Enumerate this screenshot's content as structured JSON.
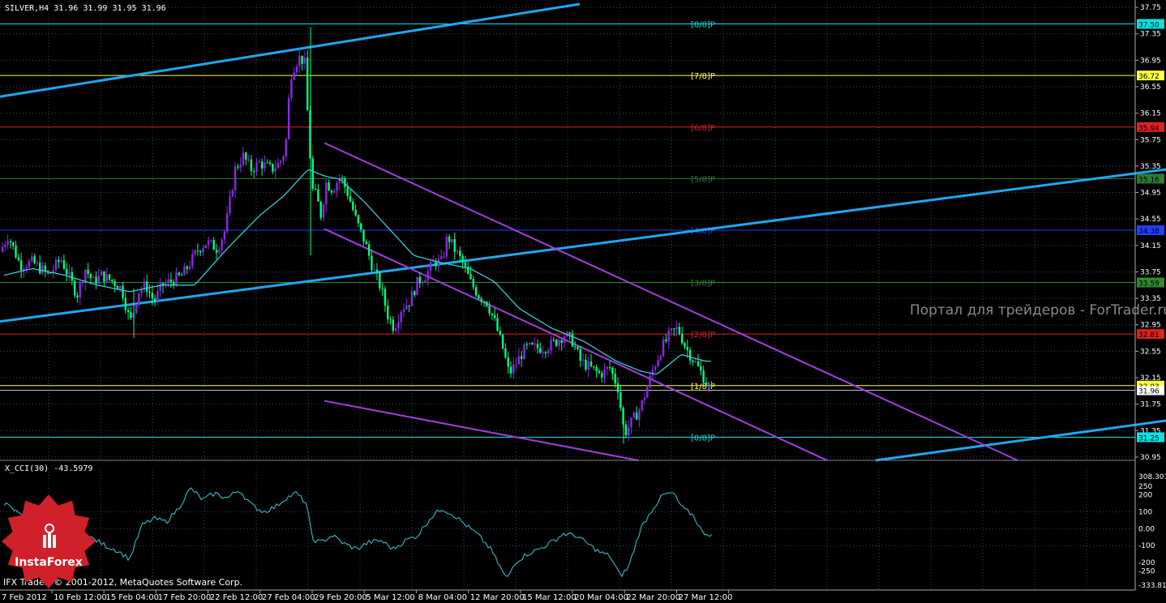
{
  "symbol_header": "SILVER,H4  31.96 31.99 31.95 31.96",
  "indicator_header": "X_CCI(30) -43.5979",
  "watermark": "Портал для трейдеров - ForTrader.ru",
  "copyright": "IFX Trader, © 2001-2012, MetaQuotes Software Corp.",
  "logo_text": "InstaForex",
  "colors": {
    "bull": "#8A2BE2",
    "bear": "#00FF7F",
    "ma": "#40C8D8",
    "channel_blue": "#1EA8F0",
    "channel_purple": "#A040E0",
    "grid": "#3A4A5A",
    "logo": "#D0202A"
  },
  "price_axis": {
    "ticks": [
      "37.75",
      "37.35",
      "36.95",
      "36.55",
      "36.15",
      "35.75",
      "35.35",
      "34.95",
      "34.55",
      "34.15",
      "33.75",
      "33.35",
      "32.95",
      "32.55",
      "32.15",
      "31.75",
      "31.35",
      "30.95"
    ],
    "min": 30.9,
    "max": 37.8
  },
  "cci_axis": {
    "ticks": [
      "308.301",
      "250",
      "200",
      "100",
      "0.00",
      "-100",
      "-200",
      "-250",
      "-333.810"
    ],
    "min": -333.81,
    "max": 308.301
  },
  "time_axis": [
    "7 Feb 2012",
    "10 Feb 12:00",
    "15 Feb 04:00",
    "17 Feb 20:00",
    "22 Feb 12:00",
    "27 Feb 04:00",
    "29 Feb 20:00",
    "5 Mar 12:00",
    "8 Mar 04:00",
    "12 Mar 20:00",
    "15 Mar 12:00",
    "20 Mar 04:00",
    "22 Mar 20:00",
    "27 Mar 12:00"
  ],
  "murrey_levels": [
    {
      "label": "[8/8]P",
      "price": 37.5,
      "tag": "37.50",
      "color": "#00E5E5"
    },
    {
      "label": "[7/8]P",
      "price": 36.72,
      "tag": "36.72",
      "color": "#FFFF40"
    },
    {
      "label": "[6/8]P",
      "price": 35.94,
      "tag": "35.94",
      "color": "#E02020"
    },
    {
      "label": "[5/8]P",
      "price": 35.16,
      "tag": "35.16",
      "color": "#2E7D32"
    },
    {
      "label": "[4/8]P",
      "price": 34.38,
      "tag": "34.38",
      "color": "#2040FF"
    },
    {
      "label": "[3/8]P",
      "price": 33.59,
      "tag": "33.59",
      "color": "#2E8B2E"
    },
    {
      "label": "[2/8]P",
      "price": 32.81,
      "tag": "32.81",
      "color": "#E02020"
    },
    {
      "label": "[1/8]P",
      "price": 32.03,
      "tag": "32.03",
      "color": "#FFFF40"
    },
    {
      "label": "[0/8]P",
      "price": 31.25,
      "tag": "31.25",
      "color": "#00E5E5"
    }
  ],
  "current_price": {
    "price": 31.96,
    "tag": "31.96"
  },
  "chart_data": {
    "type": "candlestick",
    "title": "SILVER,H4",
    "close_anchors": [
      [
        0,
        34.05
      ],
      [
        10,
        34.3
      ],
      [
        25,
        33.85
      ],
      [
        40,
        33.9
      ],
      [
        60,
        33.7
      ],
      [
        75,
        33.95
      ],
      [
        95,
        33.4
      ],
      [
        105,
        33.8
      ],
      [
        115,
        33.6
      ],
      [
        125,
        33.7
      ],
      [
        140,
        33.6
      ],
      [
        150,
        33.5
      ],
      [
        158,
        33.1
      ],
      [
        162,
        33.0
      ],
      [
        170,
        33.45
      ],
      [
        180,
        33.55
      ],
      [
        190,
        33.3
      ],
      [
        200,
        33.55
      ],
      [
        210,
        33.6
      ],
      [
        225,
        33.7
      ],
      [
        235,
        33.9
      ],
      [
        245,
        34.1
      ],
      [
        255,
        34.2
      ],
      [
        268,
        34.1
      ],
      [
        278,
        34.4
      ],
      [
        290,
        35.3
      ],
      [
        300,
        35.5
      ],
      [
        310,
        35.3
      ],
      [
        320,
        35.4
      ],
      [
        335,
        35.3
      ],
      [
        345,
        35.4
      ],
      [
        352,
        35.6
      ],
      [
        358,
        36.7
      ],
      [
        364,
        36.9
      ],
      [
        370,
        37.0
      ],
      [
        376,
        36.9
      ],
      [
        380,
        36.0
      ],
      [
        385,
        35.0
      ],
      [
        390,
        34.9
      ],
      [
        396,
        34.6
      ],
      [
        402,
        35.1
      ],
      [
        410,
        35.0
      ],
      [
        420,
        35.2
      ],
      [
        430,
        34.9
      ],
      [
        440,
        34.5
      ],
      [
        450,
        34.2
      ],
      [
        460,
        33.8
      ],
      [
        470,
        33.5
      ],
      [
        478,
        33.1
      ],
      [
        486,
        32.9
      ],
      [
        495,
        33.2
      ],
      [
        505,
        33.3
      ],
      [
        515,
        33.6
      ],
      [
        525,
        33.7
      ],
      [
        535,
        33.9
      ],
      [
        545,
        33.9
      ],
      [
        552,
        34.3
      ],
      [
        560,
        34.1
      ],
      [
        570,
        33.9
      ],
      [
        580,
        33.6
      ],
      [
        590,
        33.4
      ],
      [
        600,
        33.3
      ],
      [
        610,
        33.0
      ],
      [
        620,
        32.6
      ],
      [
        628,
        32.2
      ],
      [
        638,
        32.4
      ],
      [
        648,
        32.6
      ],
      [
        660,
        32.6
      ],
      [
        672,
        32.6
      ],
      [
        686,
        32.7
      ],
      [
        696,
        32.8
      ],
      [
        706,
        32.7
      ],
      [
        716,
        32.4
      ],
      [
        728,
        32.3
      ],
      [
        740,
        32.2
      ],
      [
        752,
        32.3
      ],
      [
        762,
        32.0
      ],
      [
        770,
        31.3
      ],
      [
        780,
        31.5
      ],
      [
        790,
        31.7
      ],
      [
        798,
        32.0
      ],
      [
        806,
        32.3
      ],
      [
        816,
        32.6
      ],
      [
        826,
        32.8
      ],
      [
        836,
        32.9
      ],
      [
        846,
        32.6
      ],
      [
        856,
        32.4
      ],
      [
        866,
        32.2
      ],
      [
        876,
        31.96
      ]
    ],
    "ma_anchors": [
      [
        5,
        33.7
      ],
      [
        40,
        33.8
      ],
      [
        80,
        33.7
      ],
      [
        120,
        33.55
      ],
      [
        160,
        33.45
      ],
      [
        200,
        33.55
      ],
      [
        240,
        33.55
      ],
      [
        280,
        34.1
      ],
      [
        320,
        34.6
      ],
      [
        350,
        34.9
      ],
      [
        380,
        35.3
      ],
      [
        400,
        35.2
      ],
      [
        420,
        35.15
      ],
      [
        450,
        34.8
      ],
      [
        480,
        34.4
      ],
      [
        510,
        34.0
      ],
      [
        540,
        33.9
      ],
      [
        580,
        33.8
      ],
      [
        610,
        33.6
      ],
      [
        640,
        33.2
      ],
      [
        680,
        32.9
      ],
      [
        720,
        32.7
      ],
      [
        760,
        32.4
      ],
      [
        790,
        32.25
      ],
      [
        810,
        32.2
      ],
      [
        840,
        32.5
      ],
      [
        870,
        32.4
      ],
      [
        880,
        32.4
      ]
    ],
    "cci_anchors": [
      [
        5,
        150
      ],
      [
        20,
        100
      ],
      [
        40,
        80
      ],
      [
        60,
        40
      ],
      [
        80,
        20
      ],
      [
        100,
        -30
      ],
      [
        115,
        -60
      ],
      [
        130,
        -100
      ],
      [
        145,
        -130
      ],
      [
        160,
        -180
      ],
      [
        175,
        20
      ],
      [
        190,
        60
      ],
      [
        205,
        40
      ],
      [
        220,
        120
      ],
      [
        235,
        240
      ],
      [
        250,
        170
      ],
      [
        265,
        210
      ],
      [
        280,
        180
      ],
      [
        295,
        230
      ],
      [
        310,
        140
      ],
      [
        325,
        100
      ],
      [
        340,
        130
      ],
      [
        352,
        180
      ],
      [
        365,
        210
      ],
      [
        378,
        150
      ],
      [
        385,
        -60
      ],
      [
        395,
        -80
      ],
      [
        410,
        -40
      ],
      [
        425,
        -90
      ],
      [
        440,
        -120
      ],
      [
        455,
        -80
      ],
      [
        470,
        -70
      ],
      [
        485,
        -120
      ],
      [
        500,
        -70
      ],
      [
        515,
        -40
      ],
      [
        530,
        60
      ],
      [
        545,
        120
      ],
      [
        560,
        80
      ],
      [
        575,
        20
      ],
      [
        590,
        -40
      ],
      [
        605,
        -120
      ],
      [
        615,
        -210
      ],
      [
        625,
        -300
      ],
      [
        635,
        -200
      ],
      [
        650,
        -150
      ],
      [
        665,
        -120
      ],
      [
        680,
        -80
      ],
      [
        695,
        -30
      ],
      [
        710,
        -40
      ],
      [
        725,
        -90
      ],
      [
        740,
        -140
      ],
      [
        752,
        -160
      ],
      [
        765,
        -280
      ],
      [
        775,
        -230
      ],
      [
        790,
        0
      ],
      [
        805,
        120
      ],
      [
        818,
        200
      ],
      [
        830,
        210
      ],
      [
        842,
        120
      ],
      [
        855,
        80
      ],
      [
        866,
        -20
      ],
      [
        880,
        -40
      ]
    ],
    "blue_channel_lines": [
      {
        "p1": [
          0,
          33.0
        ],
        "p2": [
          1438,
          35.3
        ]
      },
      {
        "p1": [
          0,
          36.4
        ],
        "p2": [
          715,
          37.8
        ]
      },
      {
        "p1": [
          1080,
          30.9
        ],
        "p2": [
          1438,
          31.5
        ]
      }
    ],
    "purple_channel_lines": [
      {
        "p1": [
          400,
          35.7
        ],
        "p2": [
          1255,
          30.9
        ]
      },
      {
        "p1": [
          400,
          34.4
        ],
        "p2": [
          1020,
          30.9
        ]
      },
      {
        "p1": [
          400,
          31.8
        ],
        "p2": [
          787,
          30.9
        ]
      }
    ]
  }
}
